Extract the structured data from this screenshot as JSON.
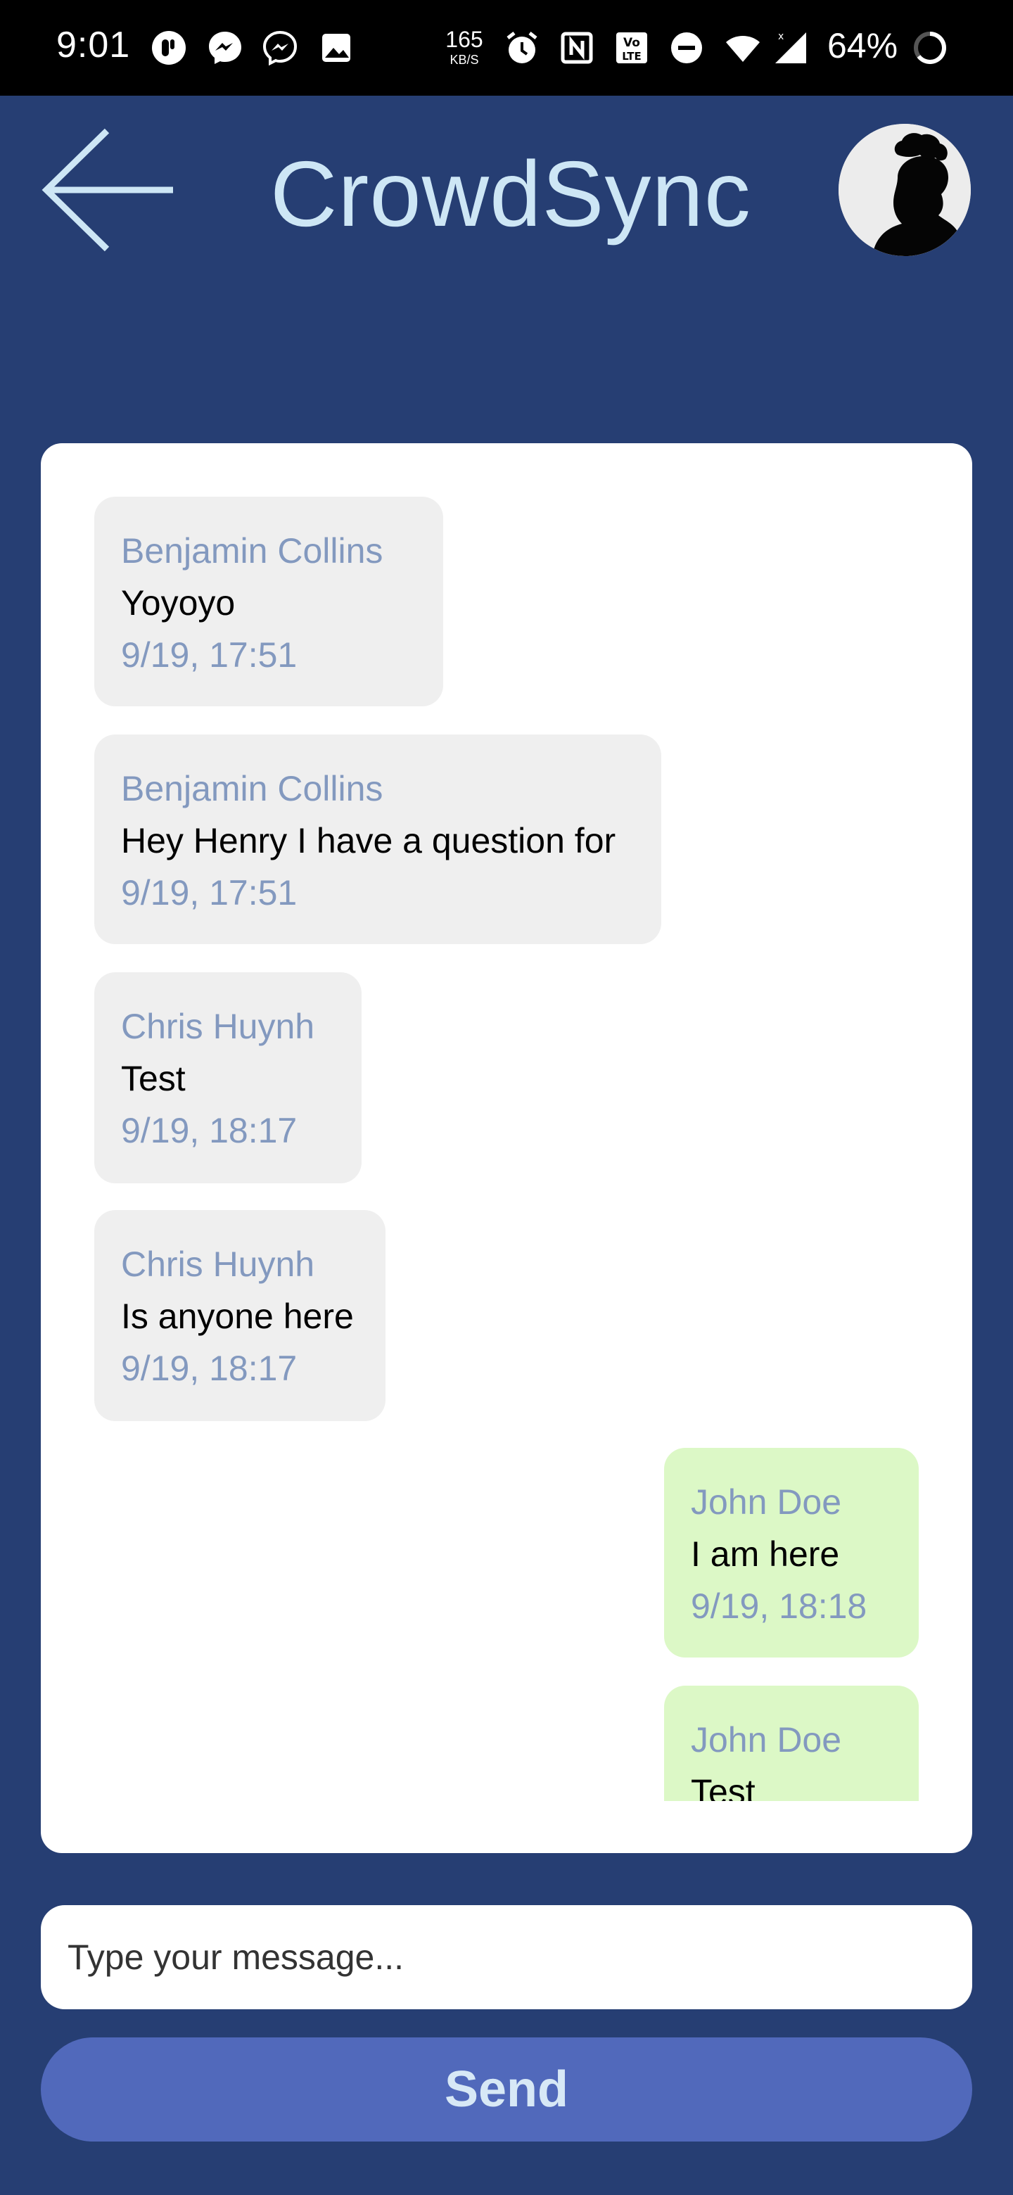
{
  "status_bar": {
    "time": "9:01",
    "net_speed": "165",
    "net_speed_unit": "KB/S",
    "battery": "64%"
  },
  "header": {
    "title": "CrowdSync",
    "back_icon": "arrow-left-icon",
    "avatar_icon": "user-silhouette-icon"
  },
  "messages": [
    {
      "sender": "Benjamin Collins",
      "text": "Yoyoyo",
      "time": "9/19, 17:51",
      "direction": "incoming"
    },
    {
      "sender": "Benjamin Collins",
      "text": "Hey Henry I have a question for",
      "time": "9/19, 17:51",
      "direction": "incoming"
    },
    {
      "sender": "Chris Huynh",
      "text": "Test",
      "time": "9/19, 18:17",
      "direction": "incoming"
    },
    {
      "sender": "Chris Huynh",
      "text": "Is anyone here",
      "time": "9/19, 18:17",
      "direction": "incoming"
    },
    {
      "sender": "John Doe",
      "text": "I am here",
      "time": "9/19, 18:18",
      "direction": "outgoing"
    },
    {
      "sender": "John Doe",
      "text": "Test",
      "time": "",
      "direction": "outgoing"
    }
  ],
  "composer": {
    "placeholder": "Type your message...",
    "value": "",
    "send_label": "Send"
  },
  "colors": {
    "background": "#263e73",
    "title": "#cde6f5",
    "incoming_bubble": "#efefef",
    "outgoing_bubble": "#dcf8c6",
    "meta_text": "#8399bf",
    "send_button": "#5169bb"
  }
}
